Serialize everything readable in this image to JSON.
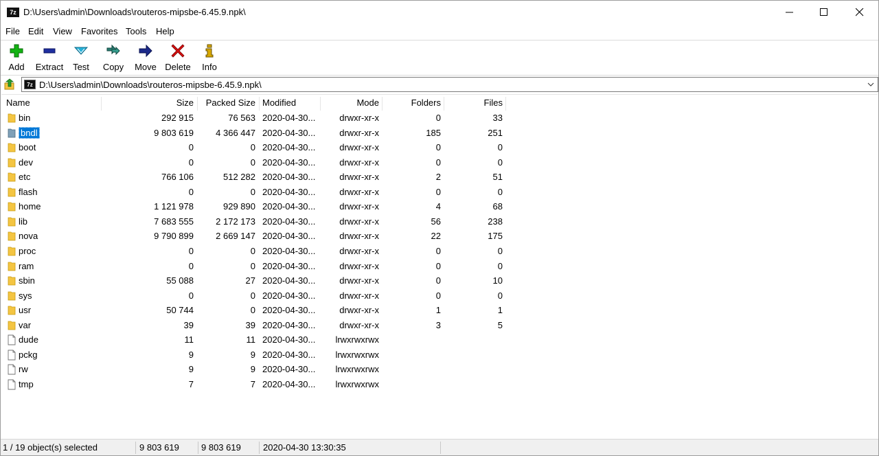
{
  "window": {
    "title": "D:\\Users\\admin\\Downloads\\routeros-mipsbe-6.45.9.npk\\"
  },
  "app_icon": "7z-logo",
  "menu": [
    "File",
    "Edit",
    "View",
    "Favorites",
    "Tools",
    "Help"
  ],
  "toolbar": [
    {
      "label": "Add",
      "icon": "plus-icon",
      "color": "#12b312"
    },
    {
      "label": "Extract",
      "icon": "minus-icon",
      "color": "#1f2fa0"
    },
    {
      "label": "Test",
      "icon": "check-icon",
      "color": "#25b0d8"
    },
    {
      "label": "Copy",
      "icon": "double-arrow-icon",
      "color": "#2a7a70"
    },
    {
      "label": "Move",
      "icon": "arrow-right-icon",
      "color": "#1c2a8a"
    },
    {
      "label": "Delete",
      "icon": "x-icon",
      "color": "#d81010"
    },
    {
      "label": "Info",
      "icon": "info-icon",
      "color": "#d8a800"
    }
  ],
  "address": {
    "path": "D:\\Users\\admin\\Downloads\\routeros-mipsbe-6.45.9.npk\\"
  },
  "columns": [
    "Name",
    "Size",
    "Packed Size",
    "Modified",
    "Mode",
    "Folders",
    "Files"
  ],
  "rows": [
    {
      "type": "folder",
      "name": "bin",
      "size": "292 915",
      "packed": "76 563",
      "modified": "2020-04-30...",
      "mode": "drwxr-xr-x",
      "folders": "0",
      "files": "33"
    },
    {
      "type": "folder",
      "name": "bndl",
      "size": "9 803 619",
      "packed": "4 366 447",
      "modified": "2020-04-30...",
      "mode": "drwxr-xr-x",
      "folders": "185",
      "files": "251",
      "selected": true
    },
    {
      "type": "folder",
      "name": "boot",
      "size": "0",
      "packed": "0",
      "modified": "2020-04-30...",
      "mode": "drwxr-xr-x",
      "folders": "0",
      "files": "0"
    },
    {
      "type": "folder",
      "name": "dev",
      "size": "0",
      "packed": "0",
      "modified": "2020-04-30...",
      "mode": "drwxr-xr-x",
      "folders": "0",
      "files": "0"
    },
    {
      "type": "folder",
      "name": "etc",
      "size": "766 106",
      "packed": "512 282",
      "modified": "2020-04-30...",
      "mode": "drwxr-xr-x",
      "folders": "2",
      "files": "51"
    },
    {
      "type": "folder",
      "name": "flash",
      "size": "0",
      "packed": "0",
      "modified": "2020-04-30...",
      "mode": "drwxr-xr-x",
      "folders": "0",
      "files": "0"
    },
    {
      "type": "folder",
      "name": "home",
      "size": "1 121 978",
      "packed": "929 890",
      "modified": "2020-04-30...",
      "mode": "drwxr-xr-x",
      "folders": "4",
      "files": "68"
    },
    {
      "type": "folder",
      "name": "lib",
      "size": "7 683 555",
      "packed": "2 172 173",
      "modified": "2020-04-30...",
      "mode": "drwxr-xr-x",
      "folders": "56",
      "files": "238"
    },
    {
      "type": "folder",
      "name": "nova",
      "size": "9 790 899",
      "packed": "2 669 147",
      "modified": "2020-04-30...",
      "mode": "drwxr-xr-x",
      "folders": "22",
      "files": "175"
    },
    {
      "type": "folder",
      "name": "proc",
      "size": "0",
      "packed": "0",
      "modified": "2020-04-30...",
      "mode": "drwxr-xr-x",
      "folders": "0",
      "files": "0"
    },
    {
      "type": "folder",
      "name": "ram",
      "size": "0",
      "packed": "0",
      "modified": "2020-04-30...",
      "mode": "drwxr-xr-x",
      "folders": "0",
      "files": "0"
    },
    {
      "type": "folder",
      "name": "sbin",
      "size": "55 088",
      "packed": "27",
      "modified": "2020-04-30...",
      "mode": "drwxr-xr-x",
      "folders": "0",
      "files": "10"
    },
    {
      "type": "folder",
      "name": "sys",
      "size": "0",
      "packed": "0",
      "modified": "2020-04-30...",
      "mode": "drwxr-xr-x",
      "folders": "0",
      "files": "0"
    },
    {
      "type": "folder",
      "name": "usr",
      "size": "50 744",
      "packed": "0",
      "modified": "2020-04-30...",
      "mode": "drwxr-xr-x",
      "folders": "1",
      "files": "1"
    },
    {
      "type": "folder",
      "name": "var",
      "size": "39",
      "packed": "39",
      "modified": "2020-04-30...",
      "mode": "drwxr-xr-x",
      "folders": "3",
      "files": "5"
    },
    {
      "type": "file",
      "name": "dude",
      "size": "11",
      "packed": "11",
      "modified": "2020-04-30...",
      "mode": "lrwxrwxrwx",
      "folders": "",
      "files": ""
    },
    {
      "type": "file",
      "name": "pckg",
      "size": "9",
      "packed": "9",
      "modified": "2020-04-30...",
      "mode": "lrwxrwxrwx",
      "folders": "",
      "files": ""
    },
    {
      "type": "file",
      "name": "rw",
      "size": "9",
      "packed": "9",
      "modified": "2020-04-30...",
      "mode": "lrwxrwxrwx",
      "folders": "",
      "files": ""
    },
    {
      "type": "file",
      "name": "tmp",
      "size": "7",
      "packed": "7",
      "modified": "2020-04-30...",
      "mode": "lrwxrwxrwx",
      "folders": "",
      "files": ""
    }
  ],
  "status": {
    "selection": "1 / 19 object(s) selected",
    "size": "9 803 619",
    "packed": "9 803 619",
    "modified": "2020-04-30 13:30:35"
  },
  "colors": {
    "folder": "#f4c542",
    "selection": "#0078d7",
    "selection_row": "#cce4f7"
  }
}
